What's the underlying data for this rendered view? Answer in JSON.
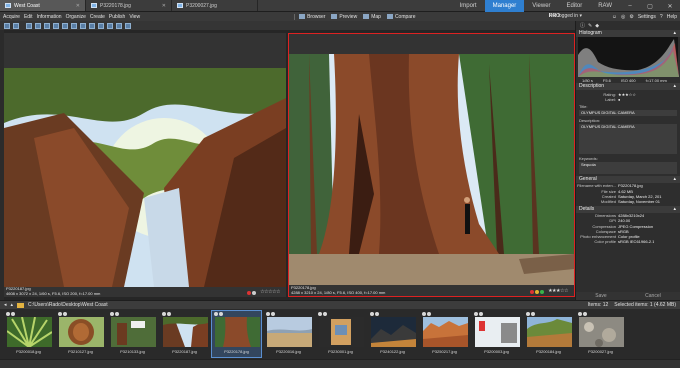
{
  "tabs": [
    {
      "label": "West Coast",
      "active": true
    },
    {
      "label": "P3220178.jpg",
      "active": false
    },
    {
      "label": "P3200027.jpg",
      "active": false
    }
  ],
  "modes": [
    "Import",
    "Manager",
    "Viewer",
    "Editor",
    "RAW"
  ],
  "active_mode": "Manager",
  "menu": [
    "Acquire",
    "Edit",
    "Information",
    "Organize",
    "Create",
    "Publish",
    "View"
  ],
  "toolbar": {
    "browser": "Browser",
    "preview": "Preview",
    "map": "Map",
    "compare": "Compare"
  },
  "account": {
    "badge": "PRO",
    "user": "Not logged in"
  },
  "top_actions": [
    "Settings",
    "Help"
  ],
  "left_photo": {
    "info_line1": "P3220187.jpg",
    "info_line2": "4608 x 3072 x 24, 1/60 s, F5.6, ISO 200, f=17.00 mm"
  },
  "right_photo": {
    "info_line1": "P3220178.jpg",
    "info_line2": "4288 x 3210 x 24, 1/80 s, F5.6, ISO 400, f=17.00 mm",
    "stars": "★★★☆☆"
  },
  "sidebar": {
    "histogram_title": "Histogram",
    "exposure": {
      "shutter": "1/80 s",
      "aperture": "F5.6",
      "iso": "ISO 400",
      "focal": "f=17.00 mm"
    },
    "description_title": "Description",
    "rating_label": "Rating:",
    "rating_stars": "★★★☆☆",
    "label_label": "Label:",
    "title_label": "Title:",
    "title_value": "OLYMPUS DIGITAL CAMERA",
    "desc_label": "Description:",
    "desc_value": "OLYMPUS DIGITAL CAMERA",
    "keywords_label": "Keywords:",
    "keywords_value": "Sequoia",
    "general_title": "General",
    "general": [
      {
        "k": "Filename with exten...",
        "v": "P3220178.jpg"
      },
      {
        "k": "File size",
        "v": "4.62 MB"
      },
      {
        "k": "Created",
        "v": "Saturday, March 22, 201"
      },
      {
        "k": "Modified",
        "v": "Saturday, November 01"
      }
    ],
    "details_title": "Details",
    "details": [
      {
        "k": "Dimensions",
        "v": "4288x3210x24"
      },
      {
        "k": "DPI",
        "v": "240.00"
      },
      {
        "k": "Compression",
        "v": "JPEG Compression"
      },
      {
        "k": "Colorspace",
        "v": "sRGB"
      },
      {
        "k": "Photo enhancement",
        "v": "Color profile"
      },
      {
        "k": "Color profile",
        "v": "sRGB IEC61966-2.1"
      },
      {
        "k": "Audio note",
        "v": "No"
      }
    ],
    "save": "Save",
    "cancel": "Cancel"
  },
  "path": {
    "location": "C:\\Users\\Rado\\Desktop\\West Coast",
    "items": "Items: 12",
    "selected": "Selected items: 1 (4.62 MB)"
  },
  "thumbs": [
    {
      "name": "P3200018.jpg",
      "selected": false
    },
    {
      "name": "P3210127.jpg",
      "selected": false
    },
    {
      "name": "P3210133.jpg",
      "selected": false
    },
    {
      "name": "P3220187.jpg",
      "selected": false
    },
    {
      "name": "P3220178.jpg",
      "selected": true
    },
    {
      "name": "P3220016.jpg",
      "selected": false
    },
    {
      "name": "P3230001.jpg",
      "selected": false
    },
    {
      "name": "P3240122.jpg",
      "selected": false
    },
    {
      "name": "P3250217.jpg",
      "selected": false
    },
    {
      "name": "P3200003.jpg",
      "selected": false
    },
    {
      "name": "P3200184.jpg",
      "selected": false
    },
    {
      "name": "P3200027.jpg",
      "selected": false
    }
  ]
}
